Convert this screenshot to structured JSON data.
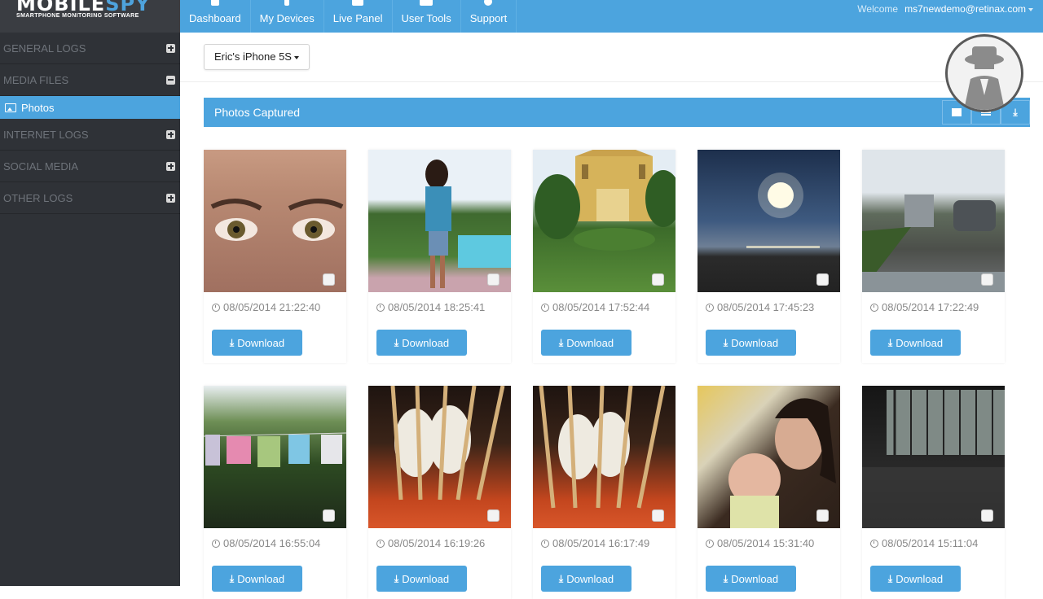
{
  "brand": {
    "name_main": "MOBILE",
    "name_accent": "SPY",
    "tagline": "SMARTPHONE MONITORING SOFTWARE"
  },
  "sidebar": {
    "items": [
      {
        "label": "GENERAL LOGS",
        "state": "collapsed"
      },
      {
        "label": "MEDIA FILES",
        "state": "expanded"
      },
      {
        "label": "INTERNET LOGS",
        "state": "collapsed"
      },
      {
        "label": "SOCIAL MEDIA",
        "state": "collapsed"
      },
      {
        "label": "OTHER LOGS",
        "state": "collapsed"
      }
    ],
    "subitem": {
      "label": "Photos",
      "icon": "image-icon"
    }
  },
  "topnav": {
    "items": [
      {
        "label": "Dashboard",
        "icon": "home-icon"
      },
      {
        "label": "My Devices",
        "icon": "phone-icon"
      },
      {
        "label": "Live Panel",
        "icon": "play-icon"
      },
      {
        "label": "User Tools",
        "icon": "toolbox-icon"
      },
      {
        "label": "Support",
        "icon": "user-icon"
      }
    ],
    "welcome_label": "Welcome",
    "user": "ms7newdemo@retinax.com"
  },
  "device": {
    "selected": "Eric's iPhone 5S"
  },
  "panel": {
    "title": "Photos Captured"
  },
  "photos": [
    {
      "timestamp": "08/05/2014 21:22:40",
      "download": "Download"
    },
    {
      "timestamp": "08/05/2014 18:25:41",
      "download": "Download"
    },
    {
      "timestamp": "08/05/2014 17:52:44",
      "download": "Download"
    },
    {
      "timestamp": "08/05/2014 17:45:23",
      "download": "Download"
    },
    {
      "timestamp": "08/05/2014 17:22:49",
      "download": "Download"
    },
    {
      "timestamp": "08/05/2014 16:55:04",
      "download": "Download"
    },
    {
      "timestamp": "08/05/2014 16:19:26",
      "download": "Download"
    },
    {
      "timestamp": "08/05/2014 16:17:49",
      "download": "Download"
    },
    {
      "timestamp": "08/05/2014 15:31:40",
      "download": "Download"
    },
    {
      "timestamp": "08/05/2014 15:11:04",
      "download": "Download"
    }
  ],
  "colors": {
    "accent": "#4ca4de",
    "sidebar": "#2f3237"
  }
}
